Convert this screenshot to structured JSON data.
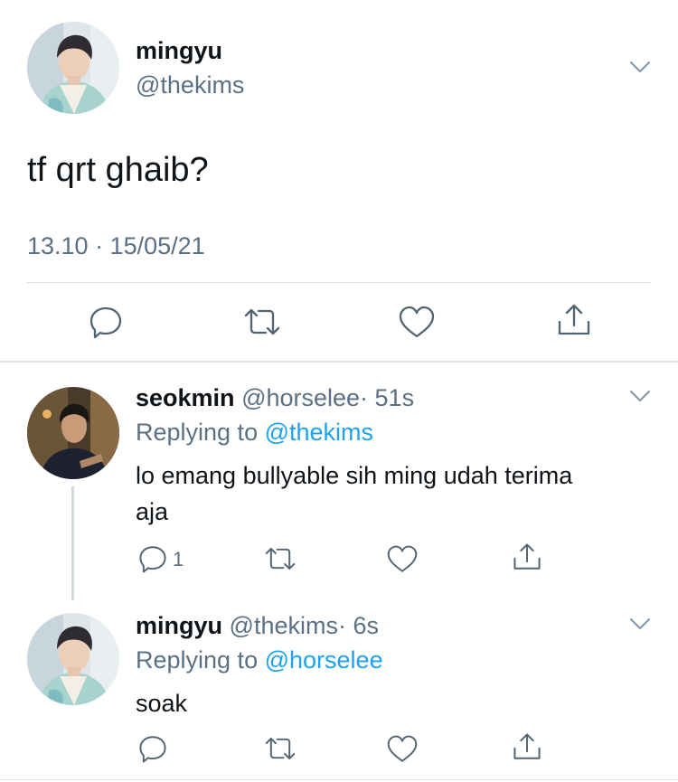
{
  "main_tweet": {
    "display_name": "mingyu",
    "handle": "@thekims",
    "text": "tf qrt ghaib?",
    "timestamp": "13.10 · 15/05/21",
    "actions": [
      "reply-icon",
      "retweet-icon",
      "like-icon",
      "share-icon"
    ]
  },
  "replies": [
    {
      "display_name": "seokmin",
      "handle": "@horselee",
      "time": "· 51s",
      "replying_prefix": "Replying to",
      "replying_to": "@thekims",
      "text_line1": "lo emang bullyable sih ming udah terima",
      "text_line2": "aja",
      "reply_count": "1"
    },
    {
      "display_name": "mingyu",
      "handle": "@thekims",
      "time": "· 6s",
      "replying_prefix": "Replying to",
      "replying_to": "@horselee",
      "text": "soak"
    }
  ],
  "colors": {
    "link": "#1da1f2",
    "secondary_text": "#5b7083",
    "icon": "#536471",
    "divider": "#dfe3e6"
  }
}
